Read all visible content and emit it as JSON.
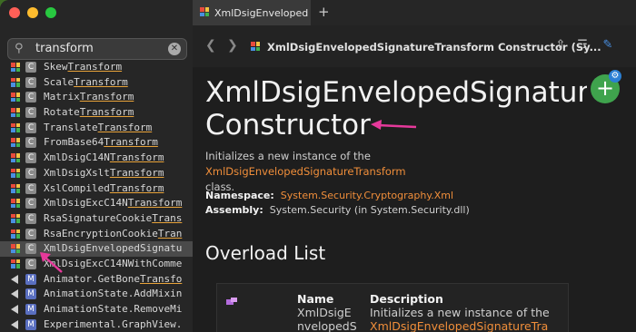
{
  "search": {
    "query": "transform"
  },
  "sidebar": {
    "items": [
      {
        "pre": "Skew",
        "match": "Transform",
        "post": "",
        "kind": "C",
        "marker": "grid"
      },
      {
        "pre": "Scale",
        "match": "Transform",
        "post": "",
        "kind": "C",
        "marker": "grid"
      },
      {
        "pre": "Matrix",
        "match": "Transform",
        "post": "",
        "kind": "C",
        "marker": "grid"
      },
      {
        "pre": "Rotate",
        "match": "Transform",
        "post": "",
        "kind": "C",
        "marker": "grid"
      },
      {
        "pre": "Translate",
        "match": "Transform",
        "post": "",
        "kind": "C",
        "marker": "grid"
      },
      {
        "pre": "FromBase64",
        "match": "Transform",
        "post": "",
        "kind": "C",
        "marker": "grid"
      },
      {
        "pre": "XmlDsigC14N",
        "match": "Transform",
        "post": "",
        "kind": "C",
        "marker": "grid"
      },
      {
        "pre": "XmlDsigXslt",
        "match": "Transform",
        "post": "",
        "kind": "C",
        "marker": "grid"
      },
      {
        "pre": "XslCompiled",
        "match": "Transform",
        "post": "",
        "kind": "C",
        "marker": "grid"
      },
      {
        "pre": "XmlDsigExcC14N",
        "match": "Transform",
        "post": "",
        "kind": "C",
        "marker": "grid"
      },
      {
        "pre": "RsaSignatureCookie",
        "match": "Trans",
        "post": "",
        "kind": "C",
        "marker": "grid"
      },
      {
        "pre": "RsaEncryptionCookie",
        "match": "Tran",
        "post": "",
        "kind": "C",
        "marker": "grid"
      },
      {
        "pre": "XmlDsigEnvelopedSignatu",
        "match": "",
        "post": "",
        "kind": "C",
        "marker": "grid",
        "selected": true
      },
      {
        "pre": "XmlDsigExcC14NWithComme",
        "match": "",
        "post": "",
        "kind": "C",
        "marker": "grid"
      },
      {
        "pre": "Animator.GetBone",
        "match": "Transfo",
        "post": "",
        "kind": "M",
        "marker": "tri"
      },
      {
        "pre": "AnimationState.AddMixin",
        "match": "",
        "post": "",
        "kind": "M",
        "marker": "tri"
      },
      {
        "pre": "AnimationState.RemoveMi",
        "match": "",
        "post": "",
        "kind": "M",
        "marker": "tri"
      },
      {
        "pre": "Experimental.GraphView.",
        "match": "",
        "post": "",
        "kind": "M",
        "marker": "tri"
      }
    ]
  },
  "tab": {
    "title": "XmlDsigEnvelopedSign"
  },
  "toolbar": {
    "title": "XmlDsigEnvelopedSignatureTransform Constructor (Sy..."
  },
  "doc": {
    "heading_line1": "XmlDsigEnvelopedSignatureT",
    "heading_line2": "Constructor",
    "desc_pre": "Initializes a new instance of the ",
    "desc_link": "XmlDsigEnvelopedSignatureTransform",
    "desc_post": "class.",
    "namespace_label": "Namespace:",
    "namespace_value": "System.Security.Cryptography.Xml",
    "assembly_label": "Assembly:",
    "assembly_value": "System.Security (in System.Security.dll)",
    "overload_heading": "Overload List",
    "table": {
      "col_name": "Name",
      "col_desc": "Description",
      "name_line1": "XmlDsigE",
      "name_line2": "nvelopedS",
      "desc_line1": "Initializes a new instance of the",
      "desc_line2": "XmlDsigEnvelopedSignatureTra"
    }
  },
  "colors": {
    "accent": "#f08e3a",
    "fab": "#3fa34d",
    "arrow": "#e6399b"
  }
}
